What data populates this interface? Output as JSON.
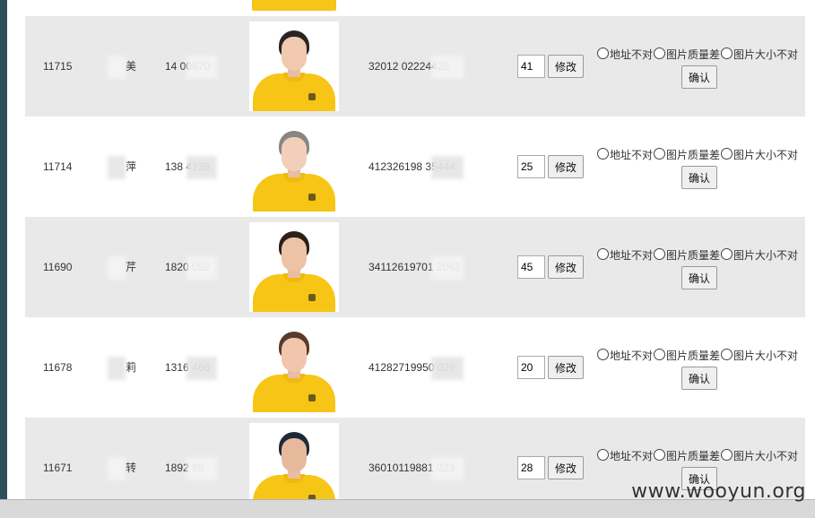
{
  "rows": [
    {
      "id": "11715",
      "name": "美",
      "phone": "14 00870",
      "id_number": "32012 02224426",
      "score": "41",
      "hair": "#2a2522",
      "face": "#f0c9b0"
    },
    {
      "id": "11714",
      "name": "萍",
      "phone": "138 4138",
      "id_number": "412326198 35444",
      "score": "25",
      "hair": "#8a8580",
      "face": "#f2cfb9"
    },
    {
      "id": "11690",
      "name": "芹",
      "phone": "1820 052",
      "id_number": "34112619701 2062",
      "score": "45",
      "hair": "#2b201a",
      "face": "#edc3a5"
    },
    {
      "id": "11678",
      "name": "莉",
      "phone": "1316 466",
      "id_number": "41282719950 029",
      "score": "20",
      "hair": "#5a3a2a",
      "face": "#f1c6ad"
    },
    {
      "id": "11671",
      "name": "转",
      "phone": "1892 98",
      "id_number": "36010119881 023",
      "score": "28",
      "hair": "#1e2a3a",
      "face": "#e7b99c"
    }
  ],
  "labels": {
    "edit": "修改",
    "opt_address": "地址不对",
    "opt_quality": "图片质量差",
    "opt_size": "图片大小不对",
    "confirm": "确认"
  },
  "watermark": "www.wooyun.org",
  "colors": {
    "row_shaded": "#e9e9e9",
    "shirt": "#f7c515",
    "sidebar": "#2f4e5c"
  }
}
